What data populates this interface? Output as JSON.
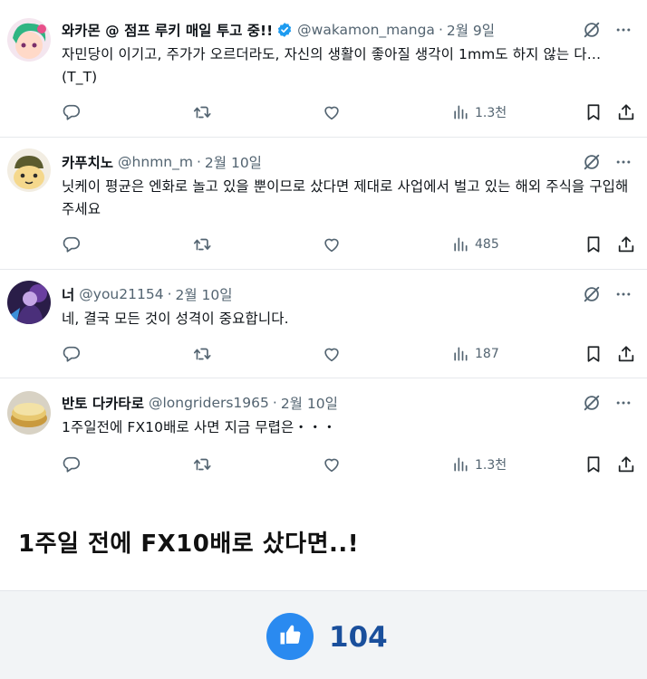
{
  "tweets": [
    {
      "name": "와카몬 @ 점프 루키 매일 투고 중!!",
      "verified": true,
      "handle": "@wakamon_manga",
      "date": "2월 9일",
      "text": "자민당이 이기고, 주가가 오르더라도, 자신의 생활이 좋아질 생각이 1mm도 하지 않는 다…(T_T)",
      "views": "1.3천"
    },
    {
      "name": "카푸치노",
      "verified": false,
      "handle": "@hnmn_m",
      "date": "2월 10일",
      "text": "닛케이 평균은 엔화로 놀고 있을 뿐이므로 샀다면 제대로 사업에서 벌고 있는 해외 주식을 구입해 주세요",
      "views": "485"
    },
    {
      "name": "너",
      "verified": false,
      "handle": "@you21154",
      "date": "2월 10일",
      "text": "네, 결국 모든 것이 성격이 중요합니다.",
      "views": "187"
    },
    {
      "name": "반토 다카타로",
      "verified": false,
      "handle": "@longriders1965",
      "date": "2월 10일",
      "text": "1주일전에 FX10배로 사면 지금 무렵은・・・",
      "views": "1.3천"
    }
  ],
  "dot": "·",
  "caption": "1주일 전에 FX10배로 샀다면..!",
  "footer": {
    "like_count": "104",
    "like_color": "#2a8af0"
  },
  "icons": [
    "reply-icon",
    "retweet-icon",
    "like-icon",
    "views-icon",
    "bookmark-icon",
    "share-icon",
    "grok-icon",
    "more-icon",
    "verified-badge-icon",
    "thumbs-up-icon"
  ]
}
